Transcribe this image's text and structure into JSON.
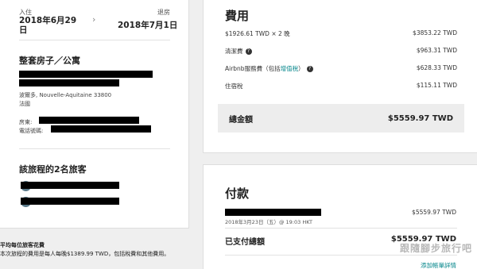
{
  "stay": {
    "checkin_label": "入住",
    "checkin_date": "2018年6月29日",
    "checkout_label": "退房",
    "checkout_date": "2018年7月1日"
  },
  "listing": {
    "title": "整套房子／公寓",
    "address_line": "波爾多, Nouvelle-Aquitaine 33800",
    "country": "法國",
    "host_label": "房東:",
    "phone_label": "電話號碼:"
  },
  "guests": {
    "title": "該旅程的2名旅客"
  },
  "fees": {
    "title": "費用",
    "rows": [
      {
        "label": "$1926.61 TWD × 2 晚",
        "amount": "$3853.22 TWD"
      },
      {
        "label": "清潔費",
        "amount": "$963.31 TWD"
      },
      {
        "label_prefix": "Airbnb服務費（包括",
        "label_link": "增值稅",
        "label_suffix": "）",
        "amount": "$628.33 TWD"
      },
      {
        "label": "住宿稅",
        "amount": "$115.11 TWD"
      }
    ],
    "total_label": "總金額",
    "total_amount": "$5559.97 TWD"
  },
  "payment": {
    "title": "付款",
    "date_line": "2018年3月23日（五）@ 19:03 HKT",
    "line_amount": "$5559.97 TWD",
    "paid_label": "已支付總額",
    "paid_amount": "$5559.97 TWD",
    "invoice_link": "添加帳單詳情"
  },
  "average": {
    "title": "平均每位旅客花費",
    "text": "本次旅程的費用是每人每晚$1389.99 TWD，包括稅費和其他費用。"
  },
  "watermark": "跟隨腳步旅行吧",
  "icons": {
    "arrow": "chevron-right-icon",
    "help": "help-circle-icon"
  },
  "colors": {
    "link": "#008489",
    "total_bg": "#ededed"
  }
}
